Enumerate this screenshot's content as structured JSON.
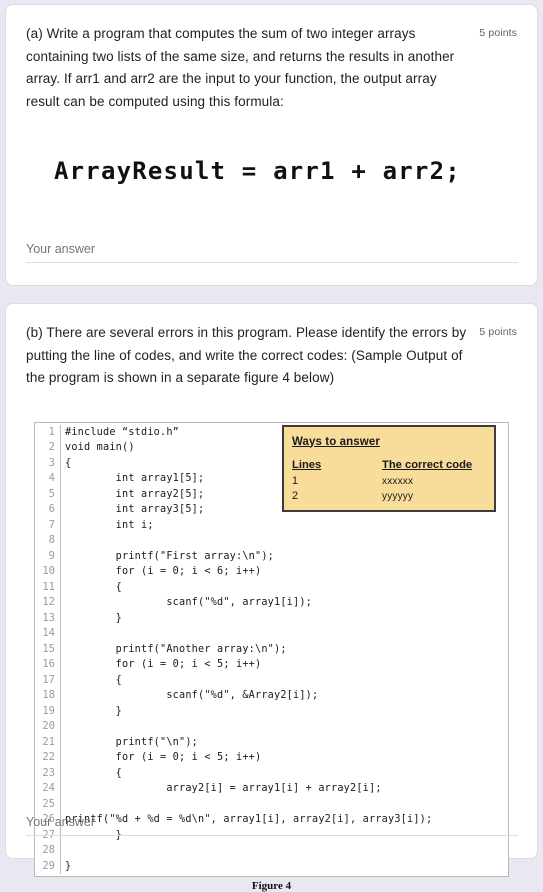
{
  "question_a": {
    "text": "(a) Write a program that computes the sum of two integer arrays containing two lists of the same size, and returns the results in another array. If arr1 and arr2 are the input to your function, the output array result can be computed using this formula:",
    "points": "5 points",
    "formula": "ArrayResult = arr1 + arr2;",
    "answer_placeholder": "Your answer"
  },
  "question_b": {
    "text": "(b) There are several errors in this program. Please identify the errors by putting the line of codes, and write the correct codes: (Sample Output of the program is shown in a separate figure 4 below)",
    "points": "5 points",
    "answer_placeholder": "Your answer",
    "figure_caption": "Figure 4",
    "code_lines": [
      {
        "n": "1",
        "text": "#include “stdio.h”"
      },
      {
        "n": "2",
        "text": "void main()"
      },
      {
        "n": "3",
        "text": "{"
      },
      {
        "n": "4",
        "text": "        int array1[5];"
      },
      {
        "n": "5",
        "text": "        int array2[5];"
      },
      {
        "n": "6",
        "text": "        int array3[5];"
      },
      {
        "n": "7",
        "text": "        int i;"
      },
      {
        "n": "8",
        "text": ""
      },
      {
        "n": "9",
        "text": "        printf(\"First array:\\n\");"
      },
      {
        "n": "10",
        "text": "        for (i = 0; i < 6; i++)"
      },
      {
        "n": "11",
        "text": "        {"
      },
      {
        "n": "12",
        "text": "                scanf(\"%d\", array1[i]);"
      },
      {
        "n": "13",
        "text": "        }"
      },
      {
        "n": "14",
        "text": ""
      },
      {
        "n": "15",
        "text": "        printf(\"Another array:\\n\");"
      },
      {
        "n": "16",
        "text": "        for (i = 0; i < 5; i++)"
      },
      {
        "n": "17",
        "text": "        {"
      },
      {
        "n": "18",
        "text": "                scanf(\"%d\", &Array2[i]);"
      },
      {
        "n": "19",
        "text": "        }"
      },
      {
        "n": "20",
        "text": ""
      },
      {
        "n": "21",
        "text": "        printf(\"\\n\");"
      },
      {
        "n": "22",
        "text": "        for (i = 0; i < 5; i++)"
      },
      {
        "n": "23",
        "text": "        {"
      },
      {
        "n": "24",
        "text": "                array2[i] = array1[i] + array2[i];"
      },
      {
        "n": "25",
        "text": ""
      },
      {
        "n": "26",
        "text": "printf(\"%d + %d = %d\\n\", array1[i], array2[i], array3[i]);"
      },
      {
        "n": "27",
        "text": "        }"
      },
      {
        "n": "28",
        "text": ""
      },
      {
        "n": "29",
        "text": "}"
      }
    ],
    "ways_table": {
      "title": "Ways to answer",
      "header": {
        "col1": "Lines",
        "col2": "The correct code"
      },
      "rows": [
        {
          "col1": "1",
          "col2": "xxxxxx"
        },
        {
          "col1": "2",
          "col2": "yyyyyy"
        }
      ]
    }
  },
  "colors": {
    "page_background": "#e9e8f2",
    "card_background": "#ffffff",
    "highlight_yellow": "#f8dc9a",
    "text_primary": "#202124",
    "text_muted": "#70757a"
  }
}
